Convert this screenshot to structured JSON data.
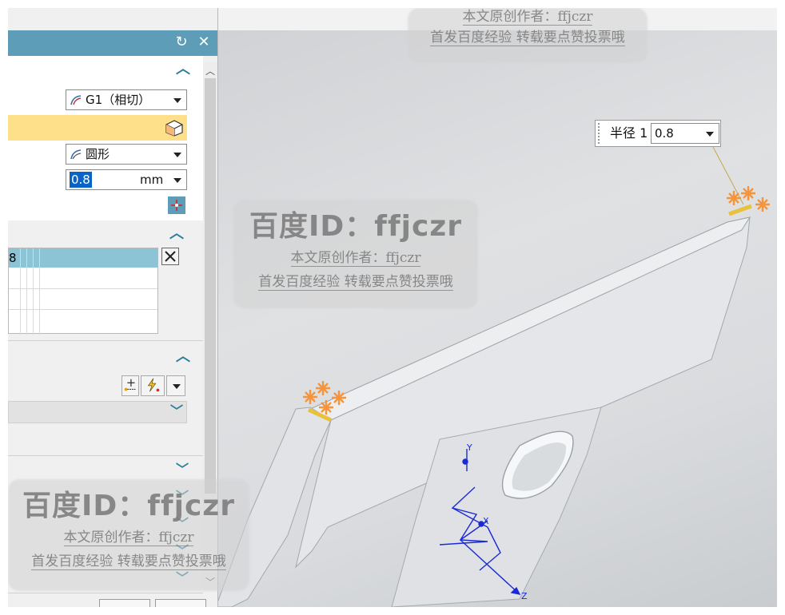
{
  "panel": {
    "tangency_combo": "G1（相切）",
    "shape_combo": "圆形",
    "radius_value": "0.8",
    "radius_unit": "mm",
    "selection_row_text": "8"
  },
  "callout": {
    "label": "半径 1",
    "value": "0.8"
  },
  "viewport": {
    "axis_y": "Y",
    "axis_x": "X",
    "axis_z": "Z"
  },
  "watermarks": {
    "title": "百度ID：ffjczr",
    "line1": "本文原创作者：ffjczr",
    "line2": "首发百度经验 转载要点赞投票哦"
  },
  "icons": [
    "refresh-icon",
    "close-icon",
    "chevron-up-icon",
    "chevron-down-icon",
    "dropdown-arrow-icon",
    "cube-icon",
    "point-add-icon",
    "lightning-icon",
    "x-icon",
    "scroll-up-icon",
    "scroll-down-icon",
    "tangent-curve-icon",
    "circle-shape-icon"
  ],
  "colors": {
    "title_bar": "#5e9db7",
    "highlight_row": "#ffe08a",
    "selected_row": "#8cc4d6",
    "accent": "#2c7c9c",
    "axis": "#1a2bd6",
    "edge_marker": "#f6943c"
  }
}
